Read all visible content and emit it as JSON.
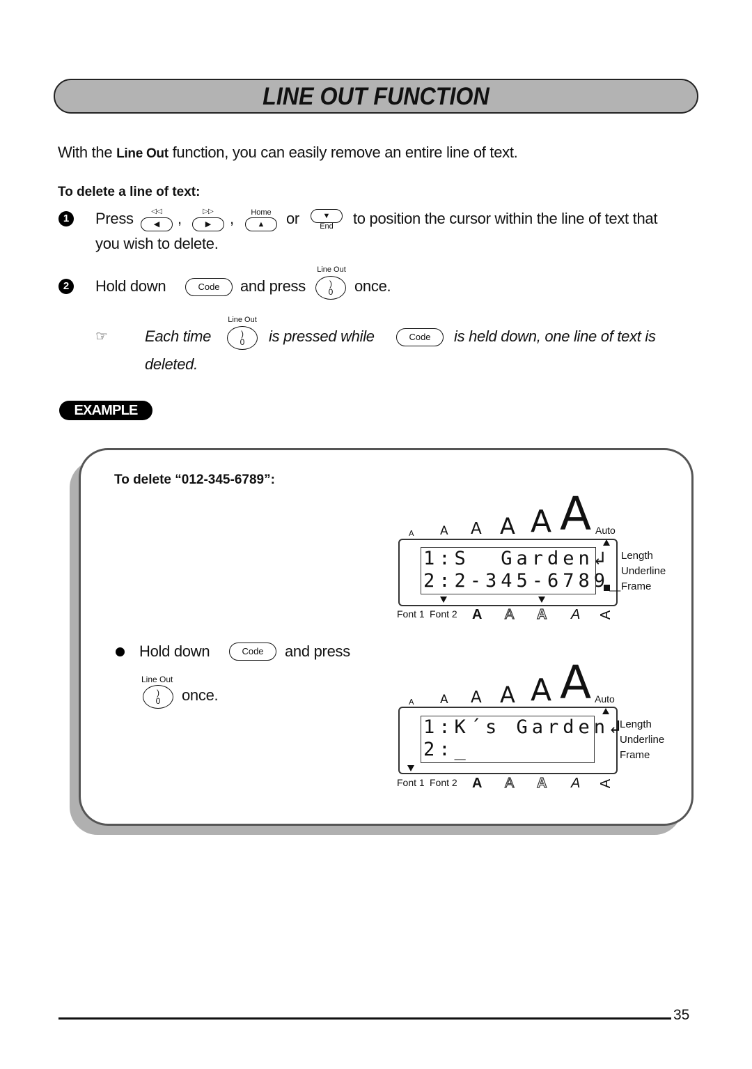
{
  "page": {
    "title": "LINE OUT FUNCTION",
    "page_number": "35"
  },
  "intro": {
    "pre": "With the ",
    "keyword": "Line Out",
    "post": " function, you can easily remove an entire line of text."
  },
  "section": {
    "heading": "To delete a line of text:",
    "steps": [
      {
        "number": "1",
        "press": "Press",
        "comma1": ",",
        "comma2": ",",
        "or": "or",
        "rest_line1": "to position the cursor within the line of text that",
        "rest_line2": "you wish to delete.",
        "keys": [
          {
            "top": "◁◁",
            "face": "◀"
          },
          {
            "top": "▷▷",
            "face": "▶"
          },
          {
            "top": "Home",
            "face": "▲"
          },
          {
            "bottom": "End",
            "face": "▼"
          }
        ]
      },
      {
        "number": "2",
        "hold": "Hold down",
        "and_press": "and press",
        "once": "once.",
        "code_key": "Code",
        "zero_key": {
          "label": "Line Out",
          "top": ")",
          "bottom": "0"
        }
      }
    ],
    "note": {
      "icon": "pointing-hand-icon",
      "each_time": "Each time",
      "is_pressed_while": "is pressed while",
      "is_held": "is held down, one line of text is",
      "deleted": "deleted.",
      "code_key": "Code",
      "zero_key": {
        "label": "Line Out",
        "top": ")",
        "bottom": "0"
      }
    }
  },
  "example": {
    "badge": "EXAMPLE",
    "heading": "To delete “012-345-6789”:",
    "instruction": {
      "hold": "Hold down",
      "and_press": "and press",
      "once": "once.",
      "code_key": "Code",
      "zero_key": {
        "label": "Line Out",
        "top": ")",
        "bottom": "0"
      }
    },
    "lcd_before": {
      "sizes": [
        "A",
        "A",
        "A",
        "A",
        "A",
        "A"
      ],
      "auto": "Auto",
      "line1": "1:S  Garden↲",
      "line2": "2:2-345-6789_",
      "side": [
        "Length",
        "Underline",
        "Frame"
      ],
      "font1": "Font 1",
      "font2": "Font 2",
      "styles": [
        "A",
        "A",
        "A",
        "A",
        "A"
      ]
    },
    "lcd_after": {
      "sizes": [
        "A",
        "A",
        "A",
        "A",
        "A",
        "A"
      ],
      "auto": "Auto",
      "line1": "1:K´s Garden↲",
      "line2": "2:_",
      "side": [
        "Length",
        "Underline",
        "Frame"
      ],
      "font1": "Font 1",
      "font2": "Font 2",
      "styles": [
        "A",
        "A",
        "A",
        "A",
        "A"
      ]
    }
  }
}
